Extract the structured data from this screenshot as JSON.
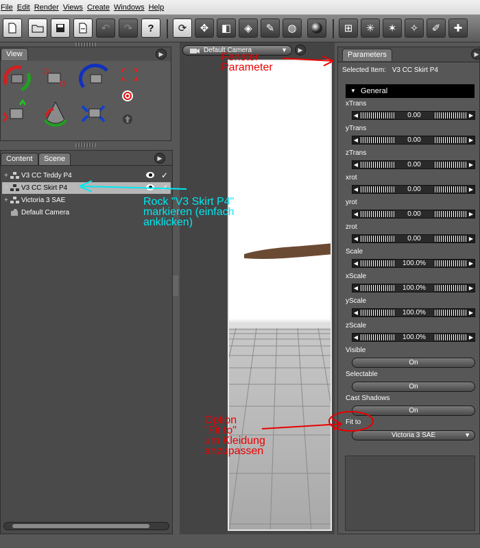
{
  "menu": [
    "File",
    "Edit",
    "Render",
    "Views",
    "Create",
    "Windows",
    "Help"
  ],
  "toolbar": {
    "help_icon": "?"
  },
  "view_panel": {
    "tab": "View"
  },
  "scene_panel": {
    "tabs": [
      "Content",
      "Scene"
    ],
    "items": [
      {
        "label": "V3 CC Teddy P4",
        "icon": "figure-icon",
        "expandable": true
      },
      {
        "label": "V3 CC Skirt P4",
        "icon": "figure-icon",
        "expandable": true,
        "selected": true
      },
      {
        "label": "Victoria 3 SAE",
        "icon": "figure-icon",
        "expandable": true
      },
      {
        "label": "Default Camera",
        "icon": "camera-icon",
        "expandable": false
      }
    ]
  },
  "viewport": {
    "camera": "Default Camera"
  },
  "parameters": {
    "tab": "Parameters",
    "selected_label": "Selected Item:",
    "selected_value": "V3 CC Skirt P4",
    "group": "General",
    "dials": [
      {
        "label": "xTrans",
        "value": "0.00"
      },
      {
        "label": "yTrans",
        "value": "0.00"
      },
      {
        "label": "zTrans",
        "value": "0.00"
      },
      {
        "label": "xrot",
        "value": "0.00"
      },
      {
        "label": "yrot",
        "value": "0.00"
      },
      {
        "label": "zrot",
        "value": "0.00"
      },
      {
        "label": "Scale",
        "value": "100.0%"
      },
      {
        "label": "xScale",
        "value": "100.0%"
      },
      {
        "label": "yScale",
        "value": "100.0%"
      },
      {
        "label": "zScale",
        "value": "100.0%"
      }
    ],
    "toggles": [
      {
        "label": "Visible",
        "value": "On"
      },
      {
        "label": "Selectable",
        "value": "On"
      },
      {
        "label": "Cast Shadows",
        "value": "On"
      }
    ],
    "fit_to_label": "Fit to",
    "fit_to_value": "Victoria 3 SAE"
  },
  "annotations": {
    "parameter_window_line1": "Fenster",
    "parameter_window_line2": "Parameter",
    "select_line1": "Rock \"V3 Skirt P4\"",
    "select_line2": "markieren (einfach",
    "select_line3": "anklicken)",
    "fit_line1": "Option",
    "fit_line2": "\"Fit to\"",
    "fit_line3": "um Kleidung",
    "fit_line4": "anzupassen"
  },
  "colors": {
    "annotation_red": "#e80000",
    "annotation_cyan": "#00e8f2",
    "panel_bg": "#4e4e4e"
  }
}
